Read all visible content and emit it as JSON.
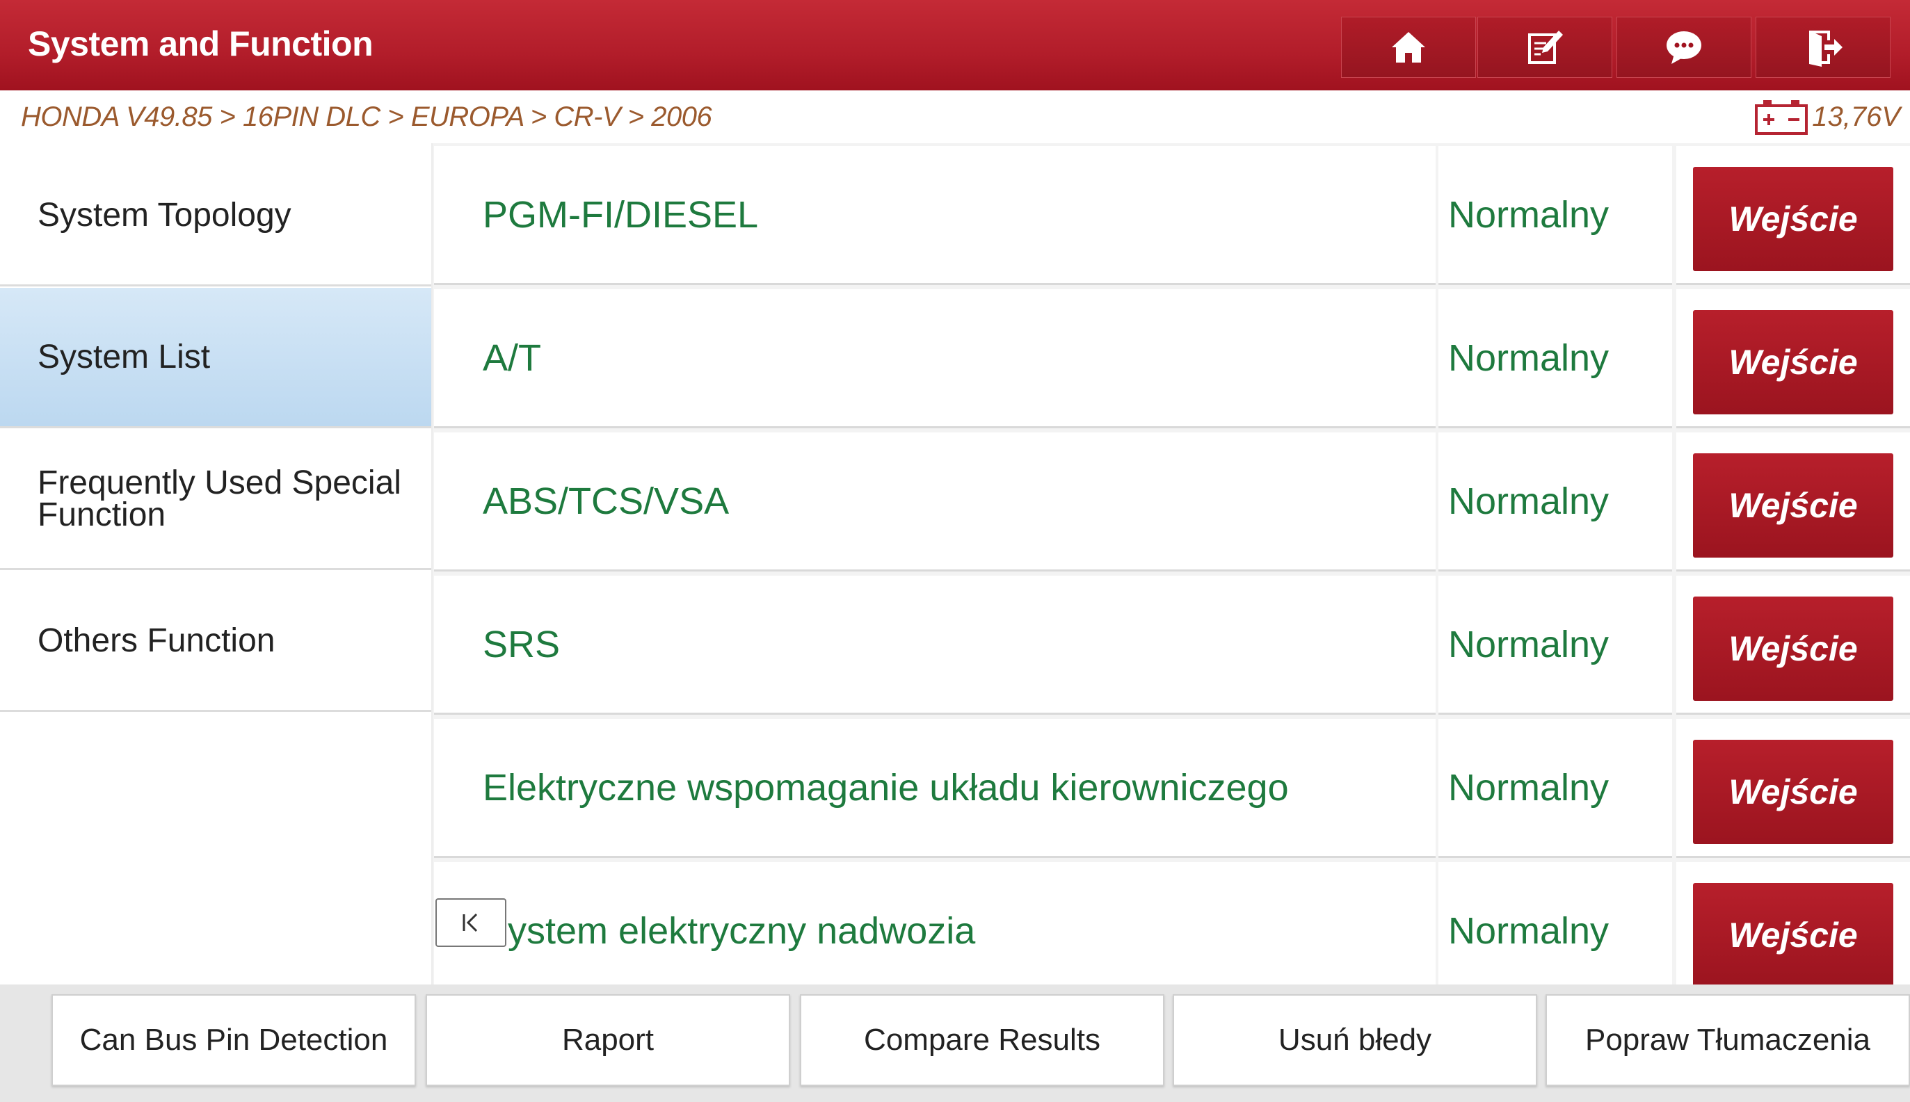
{
  "header": {
    "title": "System and Function",
    "buttons": [
      {
        "name": "home-icon"
      },
      {
        "name": "edit-icon"
      },
      {
        "name": "chat-icon"
      },
      {
        "name": "exit-icon"
      }
    ]
  },
  "breadcrumb": {
    "path": "HONDA V49.85 > 16PIN DLC > EUROPA > CR-V > 2006",
    "battery_voltage": "13,76V"
  },
  "sidebar": {
    "items": [
      {
        "label": "System Topology",
        "active": false
      },
      {
        "label": "System List",
        "active": true
      },
      {
        "label": "Frequently Used Special Function",
        "active": false
      },
      {
        "label": "Others Function",
        "active": false
      }
    ]
  },
  "systems": [
    {
      "name": "PGM-FI/DIESEL",
      "status": "Normalny",
      "button": "Wejście"
    },
    {
      "name": "A/T",
      "status": "Normalny",
      "button": "Wejście"
    },
    {
      "name": "ABS/TCS/VSA",
      "status": "Normalny",
      "button": "Wejście"
    },
    {
      "name": "SRS",
      "status": "Normalny",
      "button": "Wejście"
    },
    {
      "name": "Elektryczne wspomaganie układu kierowniczego",
      "status": "Normalny",
      "button": "Wejście"
    },
    {
      "name": "System elektryczny nadwozia",
      "status": "Normalny",
      "button": "Wejście"
    }
  ],
  "bottom_bar": {
    "buttons": [
      {
        "label": "Can Bus Pin Detection"
      },
      {
        "label": "Raport"
      },
      {
        "label": "Compare Results"
      },
      {
        "label": "Usuń błedy"
      },
      {
        "label": "Popraw Tłumaczenia"
      }
    ]
  },
  "colors": {
    "header": "#b21d2a",
    "accent_button": "#a8182a",
    "status_text": "#1e7a3e",
    "breadcrumb_text": "#9b5a2e",
    "active_sidebar": "#c8dff3"
  }
}
